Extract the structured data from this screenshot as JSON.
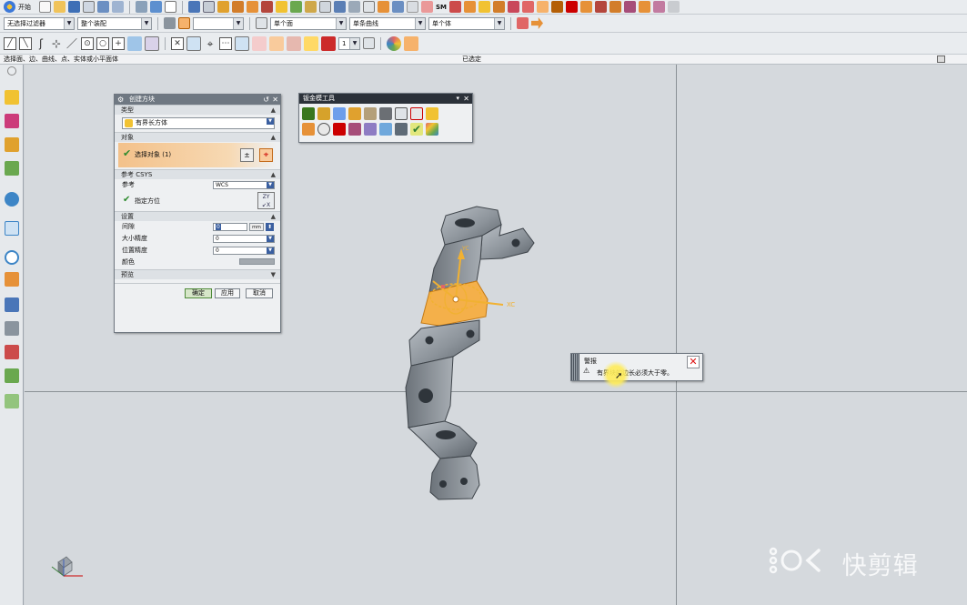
{
  "toolbar": {
    "menu_label": "开始",
    "type_filter": "无选择过滤器",
    "scope_filter": "整个装配",
    "snap_combo": "",
    "face_rule": "单个面",
    "curve_rule": "单条曲线",
    "body_rule": "单个体",
    "sm_label": "SM",
    "point_combo": "1"
  },
  "cue": {
    "prompt": "选择面、边、曲线、点、实体或小平面体",
    "status": "已选定"
  },
  "dialog": {
    "title": "创建方块",
    "sections": {
      "type": "类型",
      "object": "对象",
      "csys": "参考 CSYS",
      "settings": "设置",
      "preview": "预览"
    },
    "type_value": "有界长方体",
    "select_object": "选择对象 (1)",
    "reference_label": "参考",
    "reference_value": "WCS",
    "specify_orientation": "指定方位",
    "gap_label": "间隙",
    "gap_value": "0",
    "gap_unit": "mm",
    "size_precision_label": "大小精度",
    "size_precision_value": "0",
    "position_precision_label": "位置精度",
    "position_precision_value": "0",
    "color_label": "颜色",
    "ok": "确定",
    "apply": "应用",
    "cancel": "取消"
  },
  "sheet_toolbar": {
    "title": "钣金模工具"
  },
  "alert": {
    "title": "警报",
    "message": "有界块的边长必须大于零。"
  },
  "viewport": {
    "xc_label": "XC",
    "yc_label": "YC"
  },
  "watermark": "快剪辑",
  "colors": {
    "graphics_bg": "#d5d9dd",
    "part_gray": "#8e959c",
    "selected_orange": "#f4b04a",
    "dialog_title": "#6f7882"
  }
}
